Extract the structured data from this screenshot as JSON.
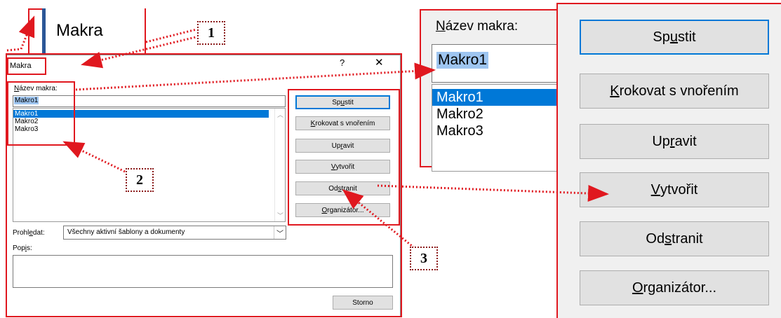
{
  "tab": {
    "title": "Makra"
  },
  "dialog": {
    "title": "Makra",
    "help": "?",
    "close": "✕",
    "name_label_prefix": "N",
    "name_label_rest": "ázev makra:",
    "name_value": "Makro1",
    "macros": [
      "Makro1",
      "Makro2",
      "Makro3"
    ],
    "buttons": {
      "run_a": "Sp",
      "run_b": "u",
      "run_c": "stit",
      "step_a": "K",
      "step_b": "rokovat s vnořením",
      "edit_a": "Up",
      "edit_b": "r",
      "edit_c": "avit",
      "create_a": "V",
      "create_b": "ytvořit",
      "delete_a": "Od",
      "delete_b": "s",
      "delete_c": "tranit",
      "org_a": "O",
      "org_b": "rganizátor...",
      "cancel": "Storno"
    },
    "search_label_a": "Prohl",
    "search_label_b": "e",
    "search_label_c": "dat:",
    "search_value": "Všechny aktivní šablony a dokumenty",
    "desc_label_a": "Pop",
    "desc_label_b": "i",
    "desc_label_c": "s:"
  },
  "zoom_name": {
    "label_prefix": "N",
    "label_rest": "ázev makra:",
    "value": "Makro1",
    "macros": [
      "Makro1",
      "Makro2",
      "Makro3"
    ]
  },
  "zoom_buttons": {
    "run_a": "Sp",
    "run_b": "u",
    "run_c": "stit",
    "step_a": "K",
    "step_b": "rokovat s vnořením",
    "edit_a": "Up",
    "edit_b": "r",
    "edit_c": "avit",
    "create_a": "V",
    "create_b": "ytvořit",
    "delete_a": "Od",
    "delete_b": "s",
    "delete_c": "tranit",
    "org_a": "O",
    "org_b": "rganizátor..."
  },
  "callouts": {
    "one": "1",
    "two": "2",
    "three": "3"
  },
  "colors": {
    "annotation_red": "#e0181f",
    "callout_border": "#8b1a1a",
    "selection_blue": "#0078d7",
    "button_face": "#e1e1e1"
  }
}
